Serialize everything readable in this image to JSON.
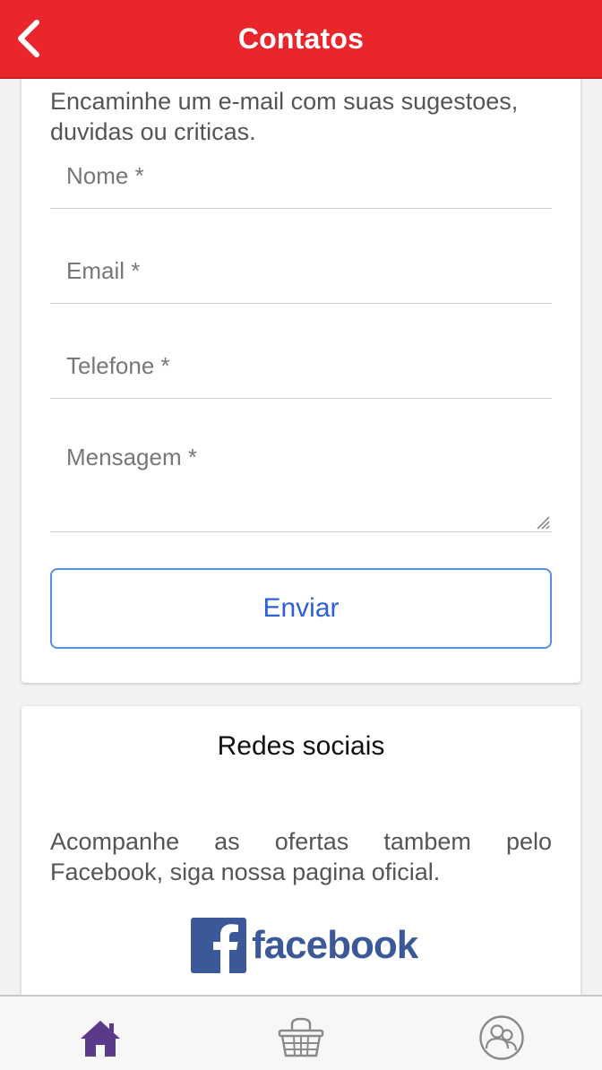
{
  "header": {
    "title": "Contatos"
  },
  "contact_form": {
    "intro": "Encaminhe um e-mail com suas sugestoes, duvidas ou criticas.",
    "fields": {
      "name_placeholder": "Nome *",
      "email_placeholder": "Email *",
      "phone_placeholder": "Telefone *",
      "message_placeholder": "Mensagem *"
    },
    "submit_label": "Enviar"
  },
  "social": {
    "title": "Redes sociais",
    "text": "Acompanhe as ofertas tambem pelo Facebook, siga nossa pagina oficial.",
    "facebook_wordmark": "facebook"
  },
  "tabbar": {
    "items": [
      {
        "icon": "home-icon",
        "active": true
      },
      {
        "icon": "basket-icon",
        "active": false
      },
      {
        "icon": "users-icon",
        "active": false
      }
    ]
  },
  "colors": {
    "header_bg": "#e8262c",
    "accent_button": "#2f5fd6",
    "facebook_blue": "#3b5998",
    "tab_active": "#5b3a8c",
    "tab_inactive": "#8a8a8a"
  }
}
